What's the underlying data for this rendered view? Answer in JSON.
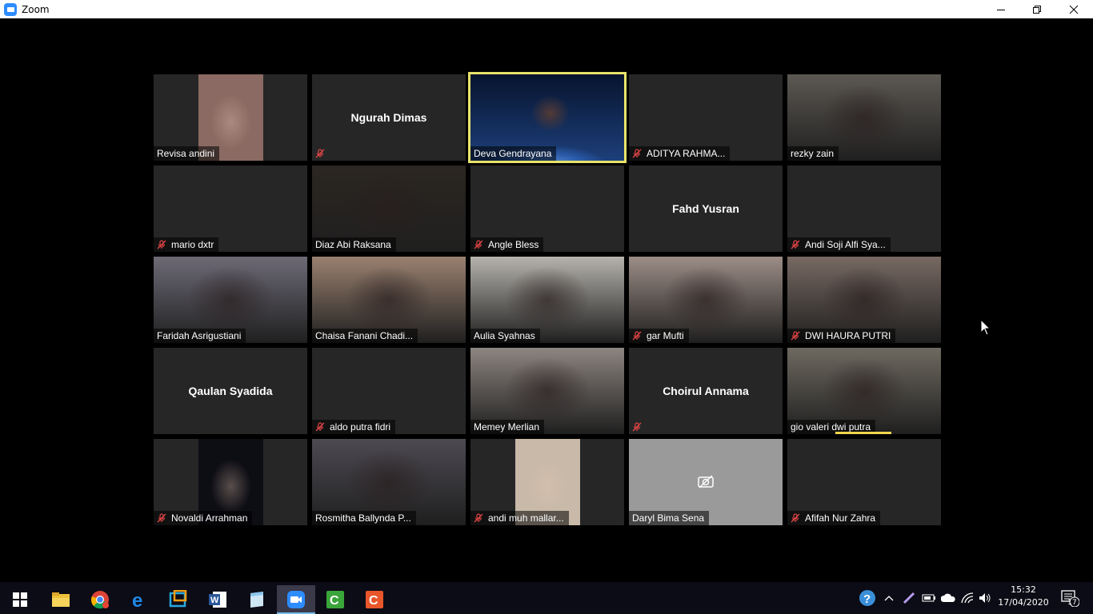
{
  "window": {
    "title": "Zoom"
  },
  "participants": [
    {
      "name": "Revisa andini",
      "muted": false,
      "video": "portrait",
      "tone": "#8a6a62"
    },
    {
      "name": "Ngurah Dimas",
      "muted": true,
      "video": "none",
      "display": "Ngurah Dimas"
    },
    {
      "name": "Deva Gendrayana",
      "muted": false,
      "video": "space",
      "tone": "#1d3f7a",
      "active": true
    },
    {
      "name": "ADITYA RAHMA...",
      "muted": true,
      "video": "none"
    },
    {
      "name": "rezky zain",
      "muted": false,
      "video": "full",
      "tone": "#5c5852"
    },
    {
      "name": "mario dxtr",
      "muted": true,
      "video": "none"
    },
    {
      "name": "Diaz Abi Raksana",
      "muted": false,
      "video": "full",
      "tone": "#2b2621"
    },
    {
      "name": "Angle Bless",
      "muted": true,
      "video": "none"
    },
    {
      "name": "Fahd Yusran",
      "muted": false,
      "video": "none",
      "display": "Fahd Yusran",
      "hide_tag": true
    },
    {
      "name": "Andi Soji Alfi Sya...",
      "muted": true,
      "video": "none"
    },
    {
      "name": "Faridah Asrigustiani",
      "muted": false,
      "video": "full",
      "tone": "#6d6a76"
    },
    {
      "name": "Chaisa Fanani Chadi...",
      "muted": false,
      "video": "full",
      "tone": "#9a8170"
    },
    {
      "name": "Aulia Syahnas",
      "muted": false,
      "video": "full",
      "tone": "#b6b3ad"
    },
    {
      "name": "gar Mufti",
      "muted": true,
      "video": "full",
      "tone": "#9c8d86"
    },
    {
      "name": "DWI HAURA PUTRI",
      "muted": true,
      "video": "full",
      "tone": "#776962"
    },
    {
      "name": "Qaulan Syadida",
      "muted": false,
      "video": "none",
      "display": "Qaulan Syadida",
      "hide_tag": true
    },
    {
      "name": "aldo putra fidri",
      "muted": true,
      "video": "none"
    },
    {
      "name": "Memey Merlian",
      "muted": false,
      "video": "full",
      "tone": "#8d8580"
    },
    {
      "name": "Choirul Annama",
      "muted": true,
      "video": "none",
      "display": "Choirul Annama"
    },
    {
      "name": "gio valeri dwi putra",
      "muted": false,
      "video": "full",
      "tone": "#6e6960",
      "speaking": true
    },
    {
      "name": "Novaldi Arrahman",
      "muted": true,
      "video": "portrait",
      "tone": "#0d0d14"
    },
    {
      "name": "Rosmitha Ballynda P...",
      "muted": false,
      "video": "full",
      "tone": "#4d4a52"
    },
    {
      "name": "andi muh mallar...",
      "muted": true,
      "video": "portrait",
      "tone": "#c8b9a8"
    },
    {
      "name": "Daryl Bima Sena",
      "muted": false,
      "video": "camoff"
    },
    {
      "name": "Afifah Nur Zahra",
      "muted": true,
      "video": "none"
    }
  ],
  "taskbar": {
    "apps": [
      "start-icon",
      "file-explorer-icon",
      "chrome-icon",
      "edge-icon",
      "app-window-icon",
      "word-icon",
      "notepad-icon",
      "zoom-icon",
      "camtasia-icon",
      "snagit-icon"
    ],
    "time": "15:32",
    "date": "17/04/2020",
    "notifications": "17"
  },
  "colors": {
    "active_speaker_border": "#e8e36a",
    "zoom_blue": "#2D8CFF",
    "muted_red": "#e04545"
  }
}
